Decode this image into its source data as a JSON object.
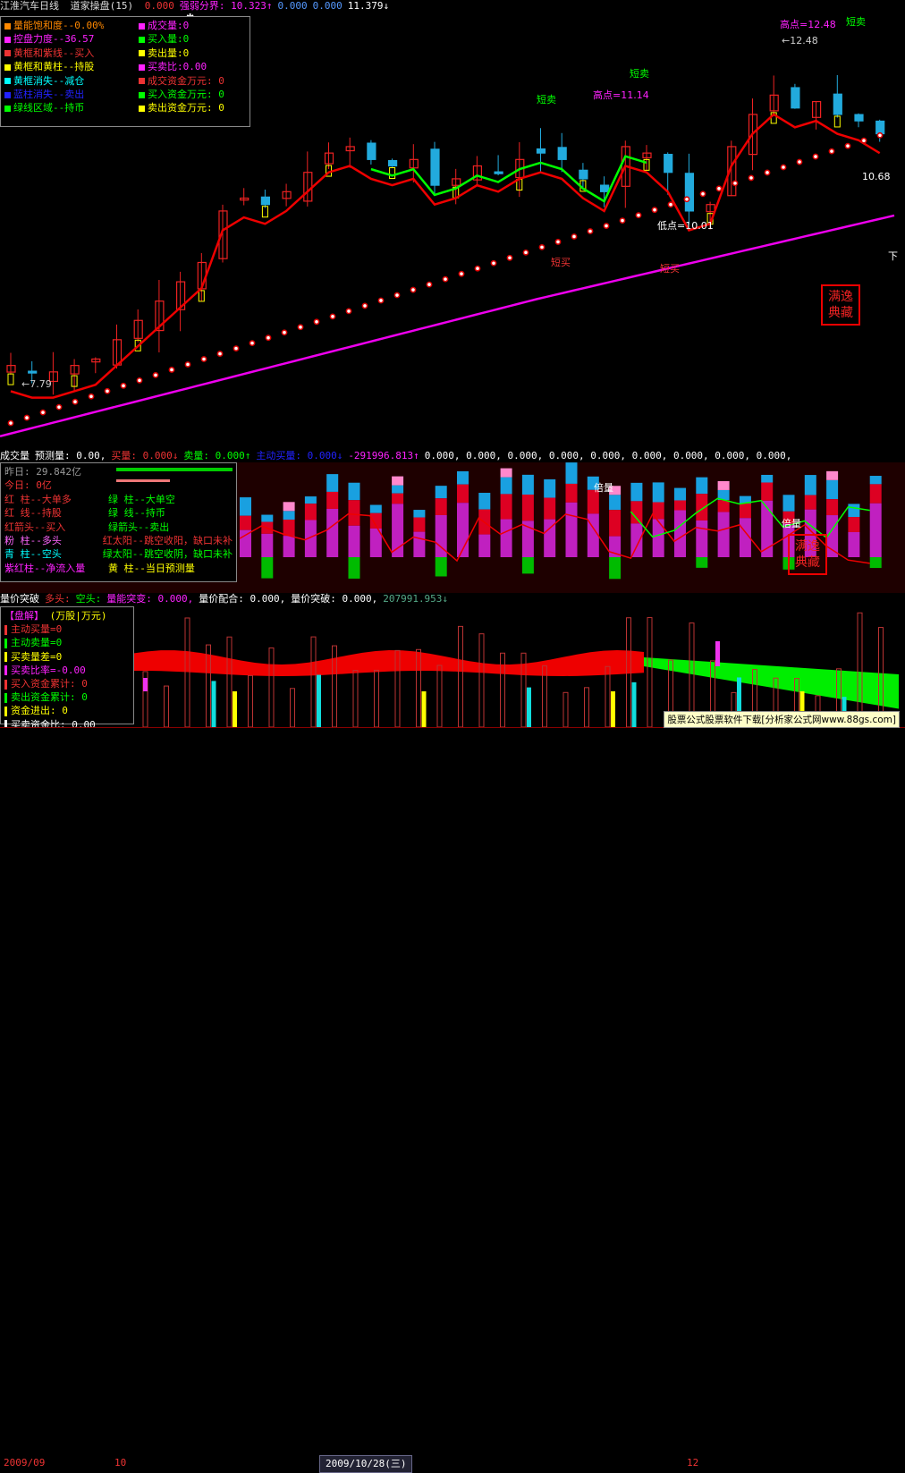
{
  "header_main": {
    "title": "江淮汽车日线",
    "indicator": "道家操盘(15)",
    "items": [
      {
        "t": "0.000",
        "c": "#e33"
      },
      {
        "t": "强弱分界: 10.323↑",
        "c": "#f2f"
      },
      {
        "t": "0.000",
        "c": "#59f"
      },
      {
        "t": "0.000",
        "c": "#59f"
      },
      {
        "t": "11.379↓",
        "c": "#fff"
      }
    ]
  },
  "legend_left": [
    {
      "label": "量能饱和度--0.00%",
      "c": "#f80"
    },
    {
      "label": "控盘力度--36.57",
      "c": "#f2f"
    },
    {
      "label": "黄框和紫线--买入",
      "c": "#e33"
    },
    {
      "label": "黄框和黄柱--持股",
      "c": "#ff0"
    },
    {
      "label": "黄框消失--减仓",
      "c": "#0ff"
    },
    {
      "label": "蓝柱消失--卖出",
      "c": "#22f"
    },
    {
      "label": "绿线区域--持币",
      "c": "#0f0"
    }
  ],
  "legend_right": [
    {
      "label": "成交量:0",
      "c": "#f2f"
    },
    {
      "label": "买入量:0",
      "c": "#0f0"
    },
    {
      "label": "卖出量:0",
      "c": "#ff0"
    },
    {
      "label": "买卖比:0.00",
      "c": "#f2f"
    },
    {
      "label": "成交资金万元: 0",
      "c": "#e33"
    },
    {
      "label": "买入资金万元: 0",
      "c": "#0f0"
    },
    {
      "label": "卖出资金万元: 0",
      "c": "#ff0"
    }
  ],
  "annotations": {
    "high1": "高点=12.48",
    "high1b": "←12.48",
    "high2": "高点=11.14",
    "low1": "低点=10.01",
    "low_left": "←7.79",
    "right_val": "10.68",
    "short_sell": "短卖",
    "short_buy": "短买",
    "buy": "买",
    "sell": "卖",
    "plenty": "倍量",
    "star": "✱"
  },
  "stamp": {
    "line1": "满逸",
    "line2": "典藏"
  },
  "header_vol": {
    "items": [
      {
        "t": "成交量",
        "c": "#fff"
      },
      {
        "t": "预测量: 0.00,",
        "c": "#fff"
      },
      {
        "t": "买量: 0.000↓",
        "c": "#e33"
      },
      {
        "t": "卖量: 0.000↑",
        "c": "#0f0"
      },
      {
        "t": "主动买量: 0.000↓",
        "c": "#22f"
      },
      {
        "t": "-291996.813↑",
        "c": "#f2f"
      },
      {
        "t": "0.000, 0.000, 0.000, 0.000, 0.000, 0.000, 0.000, 0.000, 0.000,",
        "c": "#fff"
      }
    ]
  },
  "legend_vol": {
    "yesterday": "昨日: 29.842亿",
    "today": "今日: 0亿",
    "rows": [
      {
        "a": "红  柱--大单多",
        "ac": "#e33",
        "b": "绿  柱--大单空",
        "bc": "#0f0"
      },
      {
        "a": "红  线--持股",
        "ac": "#e33",
        "b": "绿  线--持币",
        "bc": "#0f0"
      },
      {
        "a": "红箭头--买入",
        "ac": "#e33",
        "b": "绿箭头--卖出",
        "bc": "#0f0"
      },
      {
        "a": "粉  柱--多头",
        "ac": "#f6f",
        "b": "红太阳--跳空收阳，缺口未补",
        "bc": "#e33"
      },
      {
        "a": "青  柱--空头",
        "ac": "#0ff",
        "b": "绿太阳--跳空收阴，缺口未补",
        "bc": "#0f0"
      },
      {
        "a": "紫红柱--净流入量",
        "ac": "#f2f",
        "b": "黄  柱--当日预测量",
        "bc": "#ff0"
      }
    ]
  },
  "header_money": {
    "items": [
      {
        "t": "量价突破",
        "c": "#fff"
      },
      {
        "t": "多头:",
        "c": "#e33"
      },
      {
        "t": "空头:",
        "c": "#0f0"
      },
      {
        "t": "量能突变: 0.000,",
        "c": "#f2f"
      },
      {
        "t": "量价配合: 0.000,",
        "c": "#fff"
      },
      {
        "t": "量价突破: 0.000,",
        "c": "#fff"
      },
      {
        "t": "207991.953↓",
        "c": "#5a8"
      }
    ]
  },
  "legend_money": {
    "title": "【盘解】",
    "unit": "(万股|万元)",
    "rows": [
      {
        "t": "主动买量=0",
        "c": "#e33"
      },
      {
        "t": "主动卖量=0",
        "c": "#0f0"
      },
      {
        "t": "买卖量差=0",
        "c": "#ff0"
      },
      {
        "t": "买卖比率=-0.00",
        "c": "#f2f"
      },
      {
        "t": "买入资金累计: 0",
        "c": "#e33"
      },
      {
        "t": "卖出资金累计: 0",
        "c": "#0f0"
      },
      {
        "t": "资金进出: 0",
        "c": "#ff0"
      },
      {
        "t": "买卖资金比: 0.00",
        "c": "#fff"
      }
    ]
  },
  "ad_text": "股票公式股票软件下载[分析家公式网www.88gs.com]",
  "dates": {
    "d1": "2009/09",
    "d2": "10",
    "d3": "2009/10/28(三)",
    "d4": "12"
  },
  "colors": {
    "up": "#e22",
    "down": "#2ad",
    "ma_red": "#e00",
    "ma_green": "#0f0",
    "ma_magenta": "#e0e",
    "dots": "#d00"
  },
  "chart_data": {
    "type": "candlestick",
    "title": "江淮汽车日线",
    "ylim": [
      6.8,
      13.4
    ],
    "marks": {
      "high": 12.48,
      "high_mid": 11.14,
      "low": 10.01,
      "low_left": 7.79,
      "last": 10.68
    },
    "series": [
      {
        "name": "close_path_estimate",
        "values": [
          8.0,
          7.9,
          7.9,
          8.0,
          8.1,
          8.4,
          8.7,
          9.0,
          9.3,
          9.6,
          10.4,
          10.6,
          10.5,
          10.7,
          11.0,
          11.3,
          11.4,
          11.2,
          11.1,
          11.2,
          10.8,
          10.9,
          11.1,
          11.0,
          11.2,
          11.3,
          11.2,
          10.9,
          10.7,
          11.4,
          11.3,
          11.0,
          10.4,
          10.5,
          11.4,
          11.9,
          12.2,
          12.0,
          12.1,
          11.9,
          11.8,
          11.6
        ]
      }
    ]
  }
}
